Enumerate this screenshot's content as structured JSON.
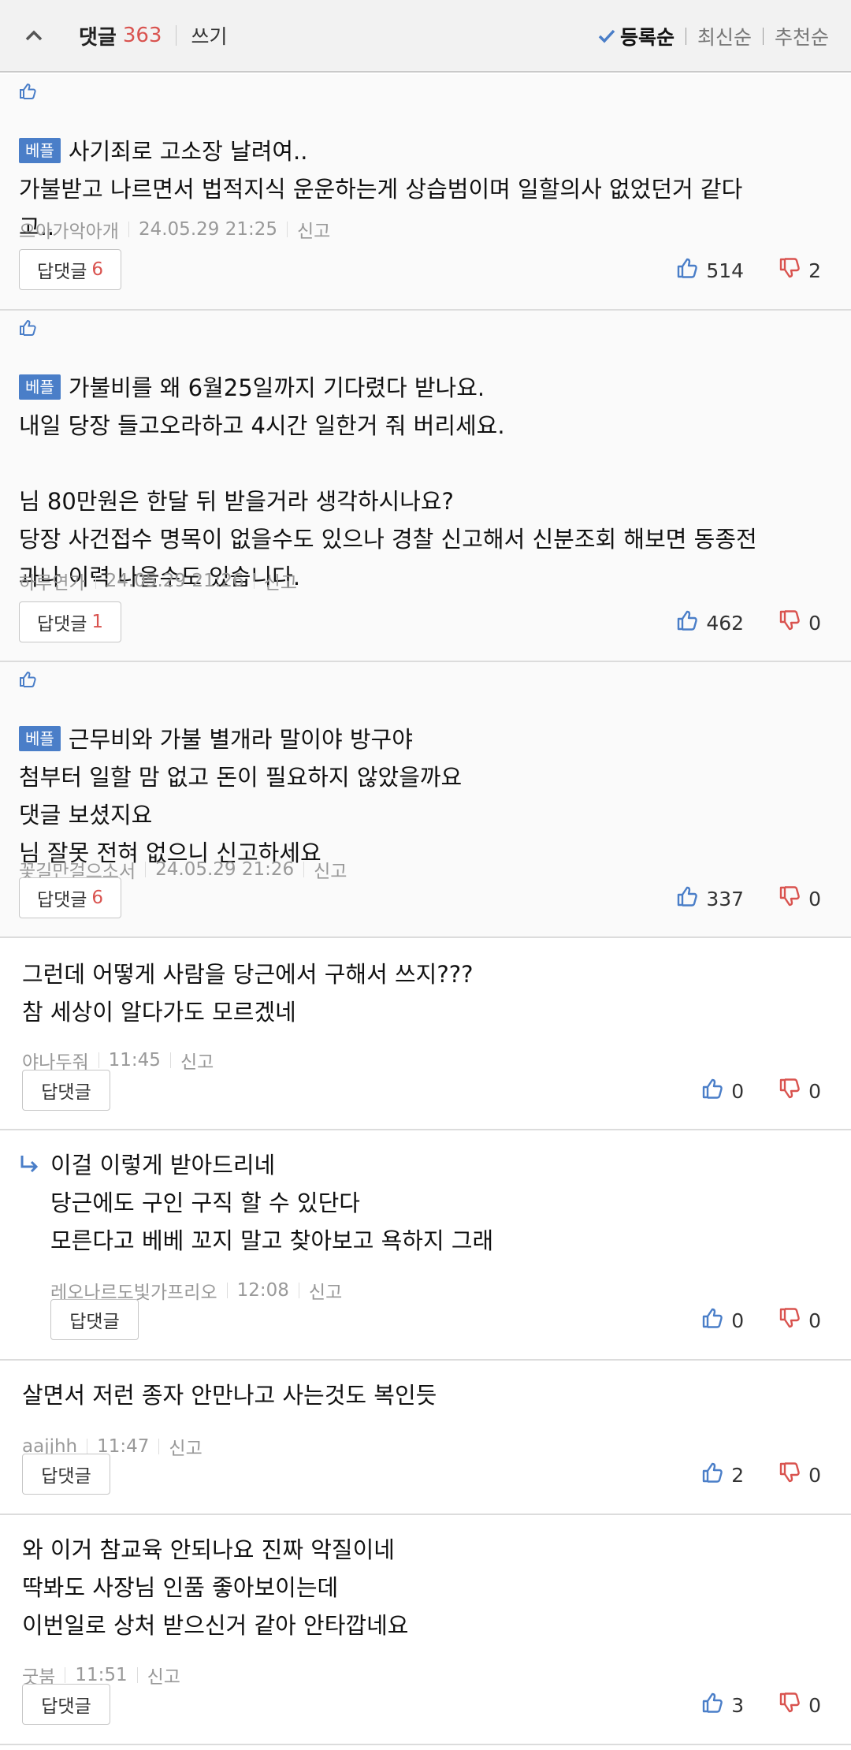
{
  "header": {
    "title": "댓글",
    "count": "363",
    "write": "쓰기",
    "sort": {
      "registered": "등록순",
      "latest": "최신순",
      "recommended": "추천순"
    }
  },
  "comments": [
    {
      "badge": "베플",
      "lines": [
        "사기죄로 고소장 날려여..",
        "가불받고 나르면서 법적지식 운운하는게 상습범이며 일할의사 없었던거 같다",
        "고.."
      ],
      "author": "으아가악아개",
      "time": "24.05.29  21:25",
      "report": "신고",
      "reply_label": "답댓글",
      "reply_count": "6",
      "likes": "514",
      "dislikes": "2"
    },
    {
      "badge": "베플",
      "lines": [
        "가불비를 왜 6월25일까지 기다렸다 받나요.",
        "내일 당장 들고오라하고 4시간 일한거 줘 버리세요.",
        "",
        "님 80만원은 한달 뒤 받을거라 생각하시나요?",
        "당장 사건접수 명목이 없을수도 있으나 경찰 신고해서 신분조회 해보면 동종전",
        "과나 이력 나올수도 있습니다."
      ],
      "author": "하루연가",
      "time": "24.05.29  21:26",
      "report": "신고",
      "reply_label": "답댓글",
      "reply_count": "1",
      "likes": "462",
      "dislikes": "0"
    },
    {
      "badge": "베플",
      "lines": [
        "근무비와 가불 별개라 말이야 방구야",
        "첨부터 일할 맘 없고 돈이 필요하지 않았을까요",
        "댓글 보셨지요",
        "님 잘못 전혀 없으니 신고하세요"
      ],
      "author": "꽃길만걸으소서",
      "time": "24.05.29  21:26",
      "report": "신고",
      "reply_label": "답댓글",
      "reply_count": "6",
      "likes": "337",
      "dislikes": "0"
    },
    {
      "lines": [
        "그런데 어떻게 사람을 당근에서 구해서 쓰지???",
        "참 세상이 알다가도 모르겠네"
      ],
      "author": "야나두줘",
      "time": "11:45",
      "report": "신고",
      "reply_label": "답댓글",
      "likes": "0",
      "dislikes": "0"
    },
    {
      "lines": [
        "이걸 이렇게 받아드리네",
        "당근에도 구인 구직 할 수 있단다",
        "모른다고 베베 꼬지 말고 찾아보고 욕하지 그래"
      ],
      "author": "레오나르도빛가프리오",
      "time": "12:08",
      "report": "신고",
      "reply_label": "답댓글",
      "likes": "0",
      "dislikes": "0"
    },
    {
      "lines": [
        "살면서 저런 종자 안만나고 사는것도 복인듯"
      ],
      "author": "aajjhh",
      "time": "11:47",
      "report": "신고",
      "reply_label": "답댓글",
      "likes": "2",
      "dislikes": "0"
    },
    {
      "lines": [
        "와 이거 참교육 안되나요 진짜 악질이네",
        "딱봐도 사장님 인품 좋아보이는데",
        "이번일로 상처 받으신거 같아 안타깝네요"
      ],
      "author": "굿붐",
      "time": "11:51",
      "report": "신고",
      "reply_label": "답댓글",
      "likes": "3",
      "dislikes": "0"
    }
  ],
  "colors": {
    "accent_red": "#d9534f",
    "badge_blue": "#4a7ec8",
    "like_blue": "#4a7ec8"
  },
  "icons": {
    "collapse": "chevron-up-icon",
    "check": "check-icon",
    "like": "thumbs-up-icon",
    "dislike": "thumbs-down-icon",
    "best": "thumbs-up-small-icon",
    "reply": "reply-arrow-icon"
  }
}
